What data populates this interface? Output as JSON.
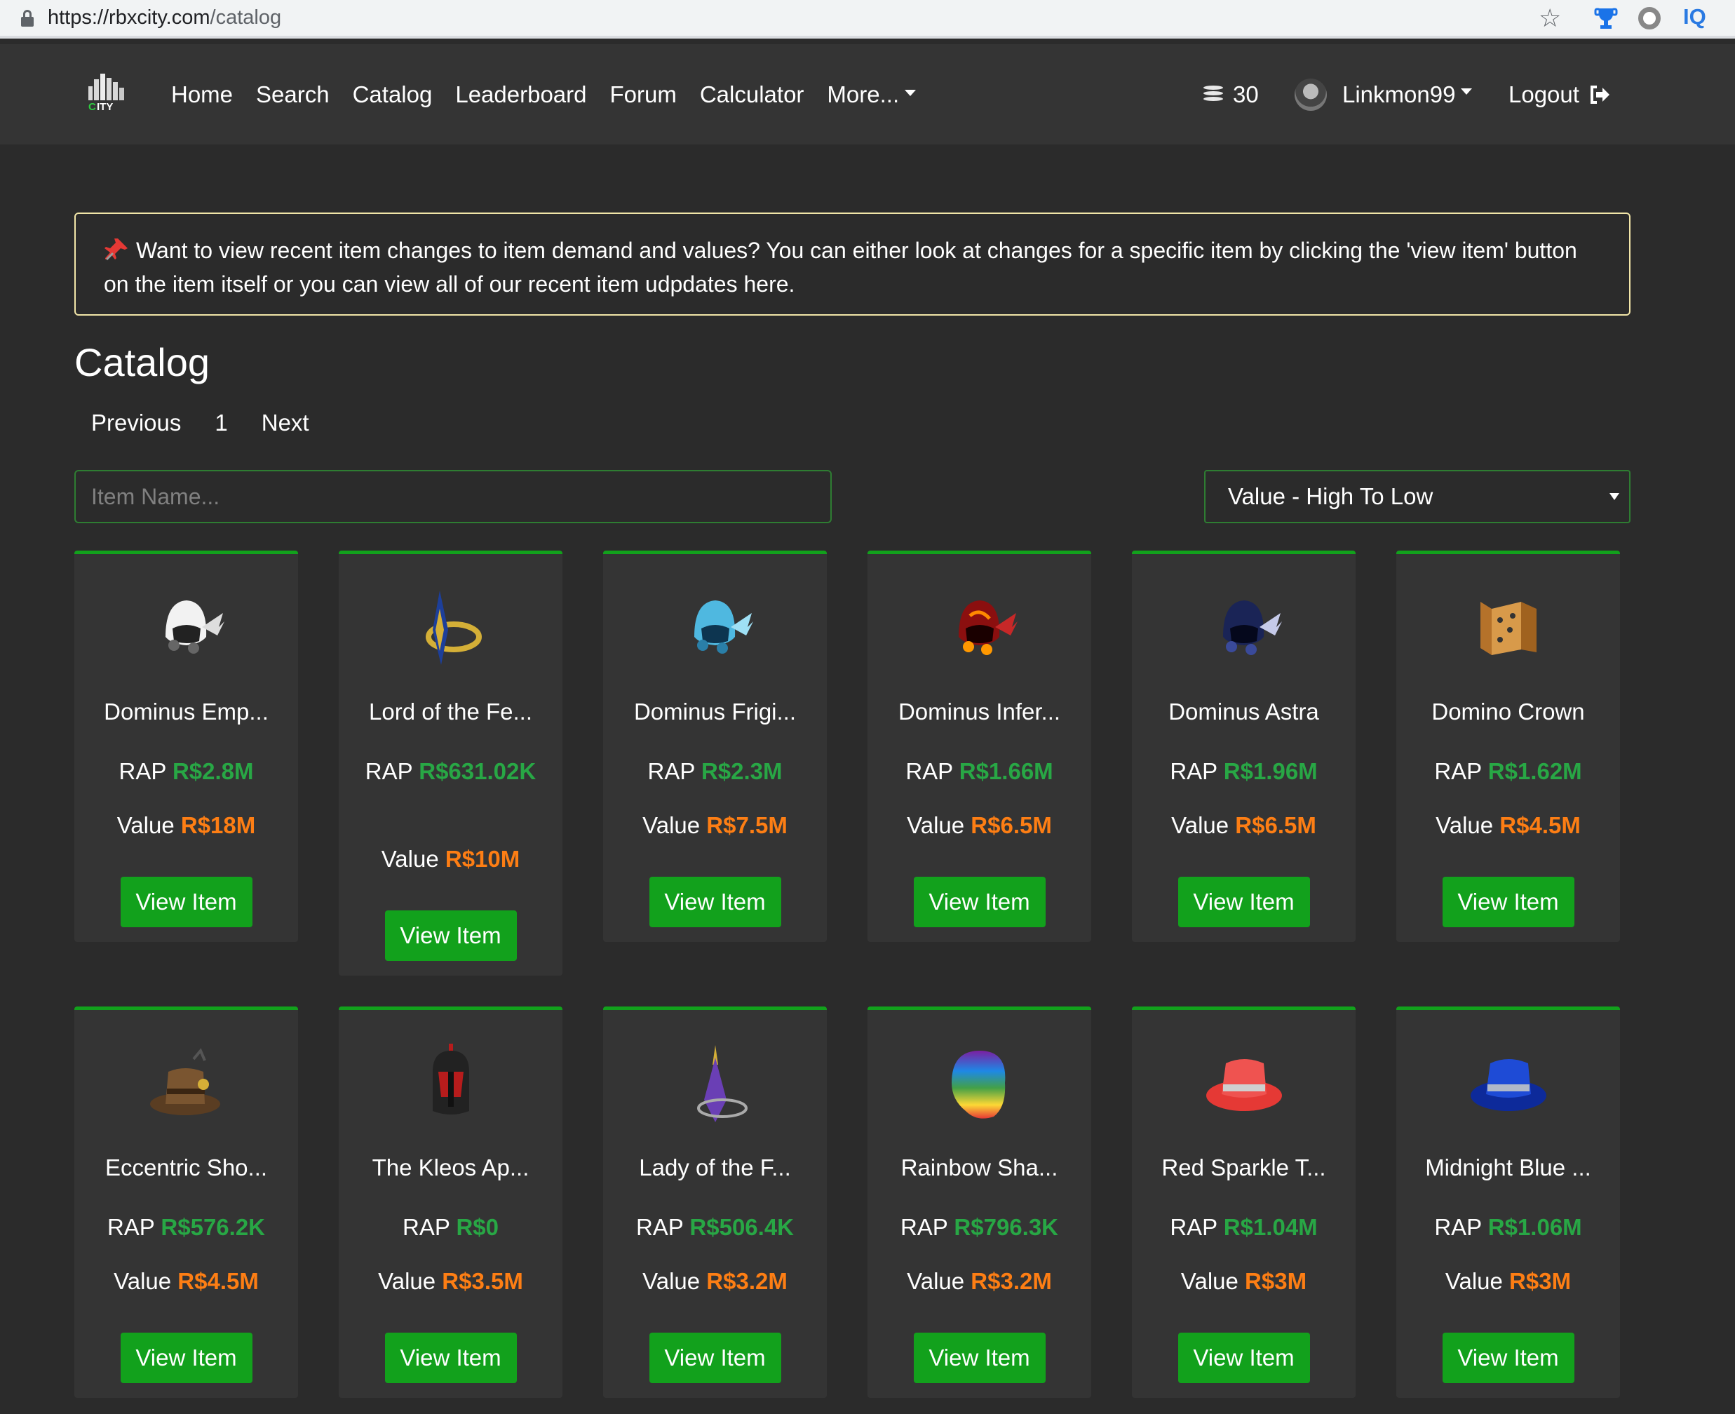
{
  "browser": {
    "url_host": "https://rbxcity.com",
    "url_path": "/catalog",
    "star_icon": "star-icon"
  },
  "nav": {
    "links": [
      "Home",
      "Search",
      "Catalog",
      "Leaderboard",
      "Forum",
      "Calculator",
      "More..."
    ],
    "coins": "30",
    "username": "Linkmon99",
    "logout": "Logout"
  },
  "alert": {
    "text": "Want to view recent item changes to item demand and values? You can either look at changes for a specific item by clicking the 'view item' button on the item itself or you can view all of our recent item udpdates here."
  },
  "page": {
    "title": "Catalog",
    "pagination": {
      "prev": "Previous",
      "current": "1",
      "next": "Next"
    },
    "search_placeholder": "Item Name...",
    "sort_selected": "Value - High To Low"
  },
  "labels": {
    "rap": "RAP",
    "value": "Value",
    "button": "View Item"
  },
  "colors": {
    "accent_green": "#12a11c",
    "rap_green": "#28a745",
    "value_orange": "#fd7e14",
    "alert_border": "#f2e6a8"
  },
  "items": [
    {
      "name": "Dominus Emp...",
      "rap": "R$2.8M",
      "value": "R$18M",
      "icon": "dominus-empyreus"
    },
    {
      "name": "Lord of the Fe...",
      "rap": "R$631.02K",
      "value": "R$10M",
      "icon": "lord-of-the-federation"
    },
    {
      "name": "Dominus Frigi...",
      "rap": "R$2.3M",
      "value": "R$7.5M",
      "icon": "dominus-frigidus"
    },
    {
      "name": "Dominus Infer...",
      "rap": "R$1.66M",
      "value": "R$6.5M",
      "icon": "dominus-infernus"
    },
    {
      "name": "Dominus Astra",
      "rap": "R$1.96M",
      "value": "R$6.5M",
      "icon": "dominus-astra"
    },
    {
      "name": "Domino Crown",
      "rap": "R$1.62M",
      "value": "R$4.5M",
      "icon": "domino-crown"
    },
    {
      "name": "Eccentric Sho...",
      "rap": "R$576.2K",
      "value": "R$4.5M",
      "icon": "eccentric-shop-teacher"
    },
    {
      "name": "The Kleos Ap...",
      "rap": "R$0",
      "value": "R$3.5M",
      "icon": "kleos-aphthiton"
    },
    {
      "name": "Lady of the F...",
      "rap": "R$506.4K",
      "value": "R$3.2M",
      "icon": "lady-of-the-federation"
    },
    {
      "name": "Rainbow Sha...",
      "rap": "R$796.3K",
      "value": "R$3.2M",
      "icon": "rainbow-shaggy"
    },
    {
      "name": "Red Sparkle T...",
      "rap": "R$1.04M",
      "value": "R$3M",
      "icon": "red-sparkle-time-fedora"
    },
    {
      "name": "Midnight Blue ...",
      "rap": "R$1.06M",
      "value": "R$3M",
      "icon": "midnight-blue-sparkle-time-fedora"
    }
  ]
}
